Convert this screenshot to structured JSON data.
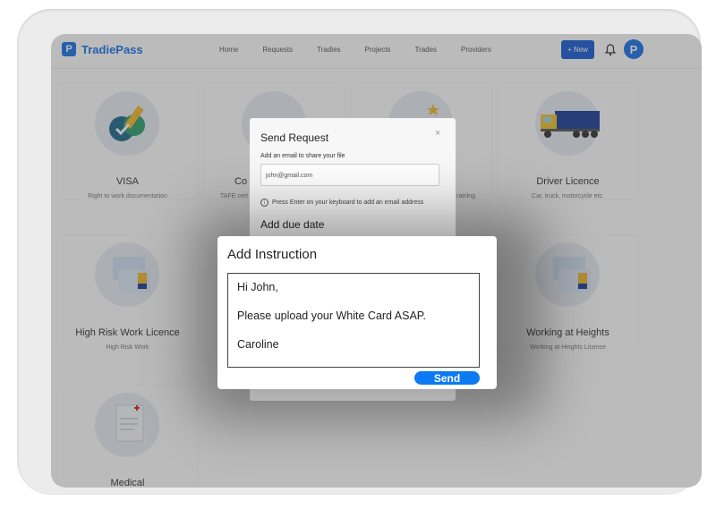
{
  "brand": {
    "name": "TradiePass",
    "logo_letter": "P",
    "avatar_letter": "P"
  },
  "nav": [
    "Home",
    "Requests",
    "Tradies",
    "Projects",
    "Trades",
    "Providers"
  ],
  "header": {
    "new_button": "+ New"
  },
  "cards": [
    {
      "title": "VISA",
      "subtitle": "Right to work documentation"
    },
    {
      "title": "Co",
      "subtitle": "TAFE cert"
    },
    {
      "title": "",
      "subtitle": "raining"
    },
    {
      "title": "Driver Licence",
      "subtitle": "Car, truck, motorcycle etc."
    },
    {
      "title": "High Risk Work Licence",
      "subtitle": "High Risk Work"
    },
    {
      "title": "Working at Heights",
      "subtitle": "Working at Heights Licence"
    },
    {
      "title": "Medical",
      "subtitle": ""
    }
  ],
  "send_modal": {
    "title": "Send Request",
    "close": "×",
    "email_label": "Add an email to share your file",
    "email_value": "john@gmail.com",
    "hint": "Press Enter on your keyboard to add an email address",
    "due_title": "Add due date"
  },
  "instruction_modal": {
    "title": "Add Instruction",
    "line1": "Hi John,",
    "line2": "Please upload your White Card ASAP.",
    "line3": "Caroline",
    "send_label": "Send"
  },
  "colors": {
    "brand_blue": "#1a73e8",
    "send_blue": "#0d79f2"
  }
}
